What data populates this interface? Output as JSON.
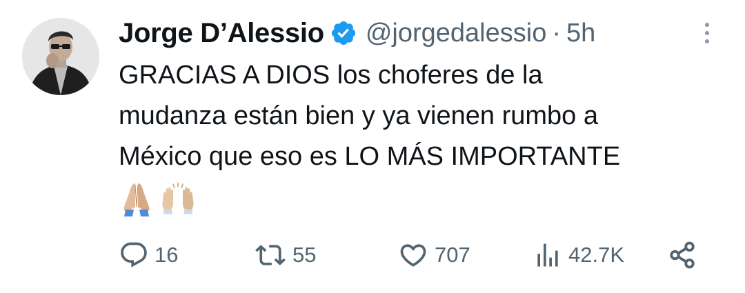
{
  "author": {
    "display_name": "Jorge D’Alessio",
    "handle": "@jorgedalessio",
    "separator": "·",
    "time": "5h",
    "verified": true
  },
  "tweet": {
    "text": "GRACIAS A DIOS los choferes de la\nmudanza están bien y ya vienen rumbo a\nMéxico que eso es LO MÁS IMPORTANTE",
    "emojis": [
      "folded-hands",
      "raising-hands"
    ]
  },
  "actions": {
    "replies": "16",
    "retweets": "55",
    "likes": "707",
    "views": "42.7K"
  },
  "colors": {
    "text": "#0f1419",
    "secondary": "#536471",
    "verified": "#1d9bf0"
  }
}
